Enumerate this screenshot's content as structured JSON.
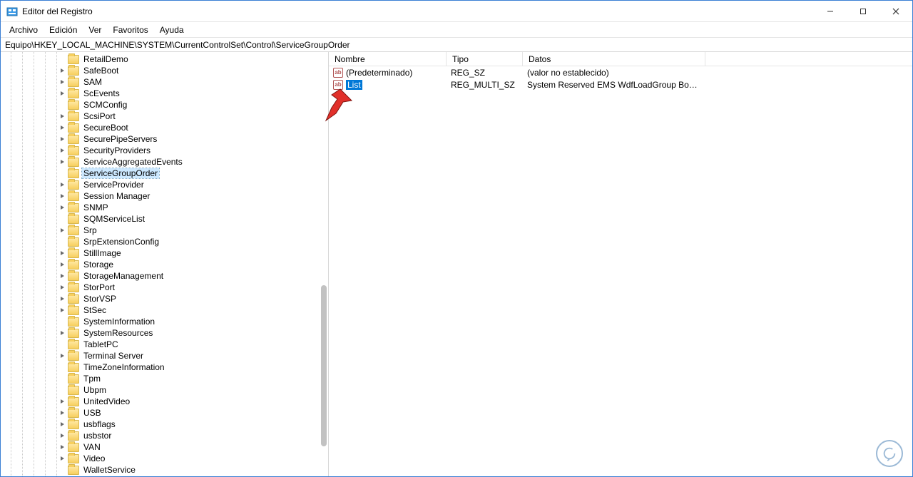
{
  "window": {
    "title": "Editor del Registro"
  },
  "menu": {
    "file": "Archivo",
    "edit": "Edición",
    "view": "Ver",
    "favorites": "Favoritos",
    "help": "Ayuda"
  },
  "addressbar": {
    "path": "Equipo\\HKEY_LOCAL_MACHINE\\SYSTEM\\CurrentControlSet\\Control\\ServiceGroupOrder"
  },
  "tree": {
    "items": [
      {
        "label": "RetailDemo",
        "expandable": false
      },
      {
        "label": "SafeBoot",
        "expandable": true
      },
      {
        "label": "SAM",
        "expandable": true
      },
      {
        "label": "ScEvents",
        "expandable": true
      },
      {
        "label": "SCMConfig",
        "expandable": false
      },
      {
        "label": "ScsiPort",
        "expandable": true
      },
      {
        "label": "SecureBoot",
        "expandable": true
      },
      {
        "label": "SecurePipeServers",
        "expandable": true
      },
      {
        "label": "SecurityProviders",
        "expandable": true
      },
      {
        "label": "ServiceAggregatedEvents",
        "expandable": true
      },
      {
        "label": "ServiceGroupOrder",
        "expandable": false,
        "selected": true
      },
      {
        "label": "ServiceProvider",
        "expandable": true
      },
      {
        "label": "Session Manager",
        "expandable": true
      },
      {
        "label": "SNMP",
        "expandable": true
      },
      {
        "label": "SQMServiceList",
        "expandable": false
      },
      {
        "label": "Srp",
        "expandable": true
      },
      {
        "label": "SrpExtensionConfig",
        "expandable": false
      },
      {
        "label": "StillImage",
        "expandable": true
      },
      {
        "label": "Storage",
        "expandable": true
      },
      {
        "label": "StorageManagement",
        "expandable": true
      },
      {
        "label": "StorPort",
        "expandable": true
      },
      {
        "label": "StorVSP",
        "expandable": true
      },
      {
        "label": "StSec",
        "expandable": true
      },
      {
        "label": "SystemInformation",
        "expandable": false
      },
      {
        "label": "SystemResources",
        "expandable": true
      },
      {
        "label": "TabletPC",
        "expandable": false
      },
      {
        "label": "Terminal Server",
        "expandable": true
      },
      {
        "label": "TimeZoneInformation",
        "expandable": false
      },
      {
        "label": "Tpm",
        "expandable": false
      },
      {
        "label": "Ubpm",
        "expandable": false
      },
      {
        "label": "UnitedVideo",
        "expandable": true
      },
      {
        "label": "USB",
        "expandable": true
      },
      {
        "label": "usbflags",
        "expandable": true
      },
      {
        "label": "usbstor",
        "expandable": true
      },
      {
        "label": "VAN",
        "expandable": true
      },
      {
        "label": "Video",
        "expandable": true
      },
      {
        "label": "WalletService",
        "expandable": false
      }
    ]
  },
  "list": {
    "columns": {
      "name": "Nombre",
      "type": "Tipo",
      "data": "Datos"
    },
    "rows": [
      {
        "name": "(Predeterminado)",
        "type": "REG_SZ",
        "data": "(valor no establecido)",
        "selected": false
      },
      {
        "name": "List",
        "type": "REG_MULTI_SZ",
        "data": "System Reserved EMS WdfLoadGroup Boot Bus Ext...",
        "selected": true
      }
    ]
  },
  "scrollbar": {
    "thumb_top_pct": 55,
    "thumb_height_pct": 38
  }
}
